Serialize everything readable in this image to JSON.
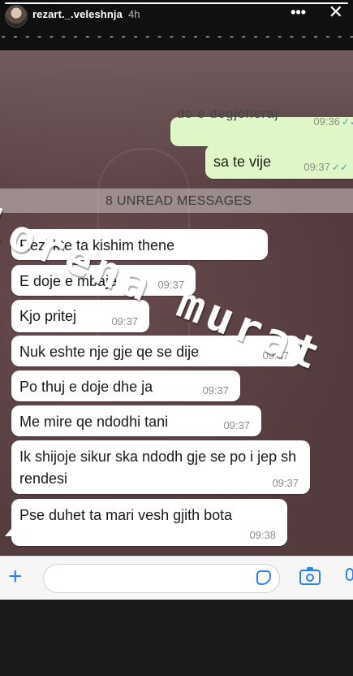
{
  "story": {
    "username": "rezart._.veleshnja",
    "time": "4h",
    "more_icon": "more-dots-icon",
    "close_icon": "close-icon",
    "progress_fraction": 1.0,
    "dashed_line": "- - - - - - - - - - - - - - - - - - - - - - - - - - - - - - - - - -"
  },
  "watermark": "lorena murat",
  "chat": {
    "outgoing": [
      {
        "text": "do e degjoheraj",
        "time": "09:36",
        "ticks": "✓✓"
      },
      {
        "text": "sa te vije",
        "time": "09:37",
        "ticks": "✓✓"
      }
    ],
    "unread_banner": "8 UNREAD MESSAGES",
    "incoming": [
      {
        "text": "Rezi kte ta kishim thene",
        "time": ""
      },
      {
        "text": "E doje e mbaje",
        "time": "09:37"
      },
      {
        "text": "Kjo pritej",
        "time": "09:37"
      },
      {
        "text": "Nuk eshte nje gje qe se dije",
        "time": "09:37"
      },
      {
        "text": "Po thuj e doje dhe ja",
        "time": "09:37"
      },
      {
        "text": "Me mire qe ndodhi tani",
        "time": "09:37"
      },
      {
        "text": "Ik shijoje sikur ska ndodh gje se po i jep sh rendesi",
        "time": "09:37"
      },
      {
        "text": "Pse duhet ta mari vesh gjith bota",
        "time": "09:38"
      }
    ]
  },
  "input_bar": {
    "add_icon": "plus-icon",
    "plus_glyph": "+",
    "placeholder": "",
    "sticker_icon": "sticker-icon",
    "camera_icon": "camera-icon",
    "mic_icon": "microphone-icon"
  },
  "colors": {
    "outgoing_bubble": "#dff7c7",
    "incoming_bubble": "#ffffff",
    "accent": "#2f80ed",
    "read_ticks": "#3a9ddf"
  }
}
